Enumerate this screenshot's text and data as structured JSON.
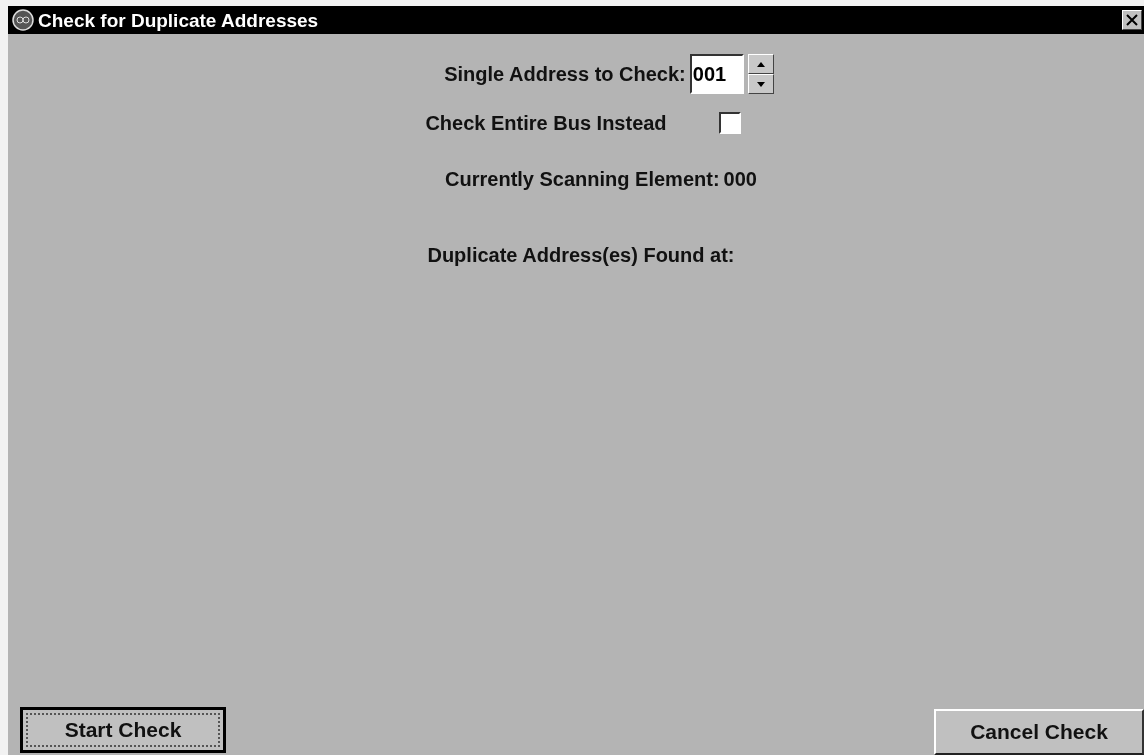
{
  "window": {
    "title": "Check for Duplicate Addresses"
  },
  "single_address": {
    "label": "Single Address to Check:",
    "value": "001"
  },
  "entire_bus": {
    "label": "Check Entire Bus Instead",
    "checked": false
  },
  "scanning": {
    "label": "Currently Scanning Element:",
    "value": "000"
  },
  "duplicates": {
    "label": "Duplicate Address(es) Found at:"
  },
  "buttons": [
    {
      "label": "Start Check",
      "default": true
    },
    {
      "label": "Cancel Check",
      "default": false
    }
  ]
}
